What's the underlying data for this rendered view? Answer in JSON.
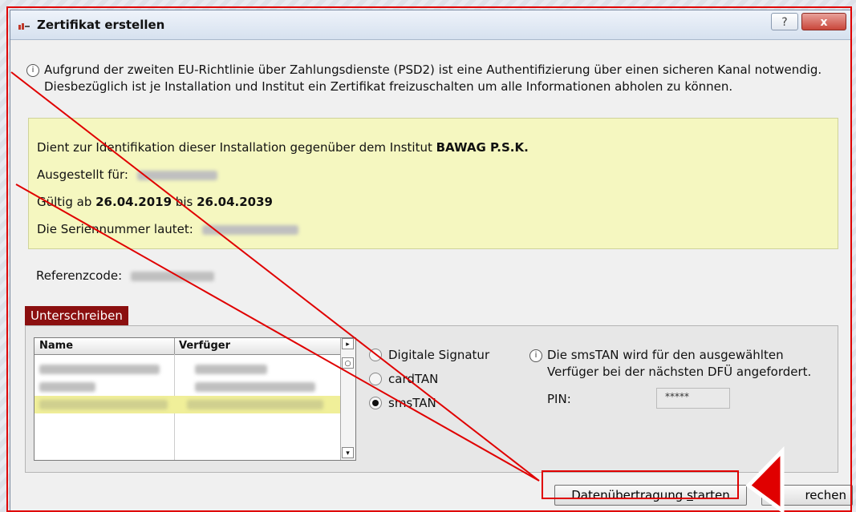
{
  "window": {
    "title": "Zertifikat erstellen",
    "help_label": "?",
    "close_label": "x"
  },
  "info": {
    "text": "Aufgrund der zweiten EU-Richtlinie über Zahlungsdienste (PSD2) ist eine Authentifizierung über einen sicheren Kanal notwendig. Diesbezüglich ist je Installation und Institut ein Zertifikat freizuschalten um alle Informationen abholen zu können."
  },
  "certificate": {
    "identification_prefix": "Dient zur Identifikation dieser Installation gegenüber dem Institut ",
    "institute": "BAWAG P.S.K.",
    "issued_for_label": "Ausgestellt für:",
    "valid_prefix": "Gültig ab ",
    "valid_from": "26.04.2019",
    "valid_mid": " bis ",
    "valid_to": "26.04.2039",
    "serial_label": "Die Seriennummer lautet:"
  },
  "reference": {
    "label": "Referenzcode:"
  },
  "sign": {
    "tab_label": "Unterschreiben",
    "columns": [
      "Name",
      "Verfüger"
    ],
    "options": [
      {
        "label": "Digitale Signatur",
        "selected": false
      },
      {
        "label": "cardTAN",
        "selected": false
      },
      {
        "label": "smsTAN",
        "selected": true
      }
    ],
    "sms_info": "Die smsTAN wird für den ausgewählten Verfüger bei der nächsten DFÜ angefordert.",
    "pin_label": "PIN:",
    "pin_value": "*****"
  },
  "buttons": {
    "start_prefix": "Datenübertragung ",
    "start_underlined": "s",
    "start_suffix": "tarten",
    "cancel_visible": "rechen"
  },
  "colors": {
    "accent_red": "#8b0f0f",
    "highlight_yellow": "#f5f7c0",
    "annotation_red": "#e00000"
  }
}
